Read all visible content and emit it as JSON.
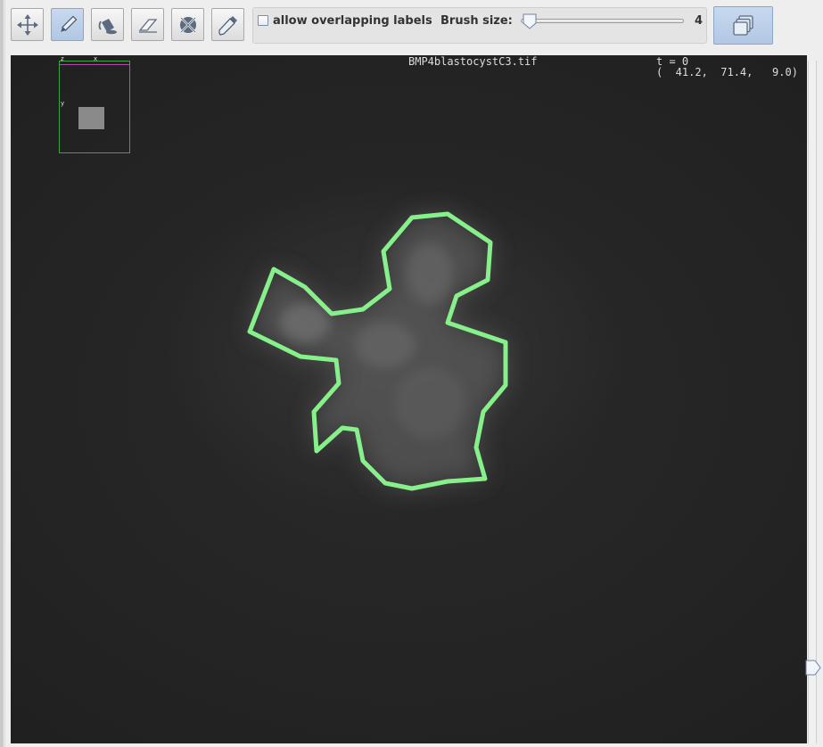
{
  "toolbar": {
    "tools": [
      {
        "id": "move",
        "icon": "move-arrows-icon",
        "active": false
      },
      {
        "id": "draw",
        "icon": "pencil-icon",
        "active": true
      },
      {
        "id": "fill",
        "icon": "paint-bucket-icon",
        "active": false
      },
      {
        "id": "erase",
        "icon": "eraser-icon",
        "active": false
      },
      {
        "id": "delete-label",
        "icon": "delete-label-icon",
        "active": false
      },
      {
        "id": "pick-label",
        "icon": "eyedropper-icon",
        "active": false
      }
    ],
    "allow_overlapping_labels": {
      "label": "allow overlapping labels",
      "checked": false
    },
    "brush_size": {
      "label": "Brush size:",
      "value": "4"
    },
    "window_button_icon": "windows-stack-icon"
  },
  "viewer": {
    "file_title": "BMP4blastocystC3.tif",
    "time_readout": "t = 0",
    "coord_readout": "(  41.2,  71.4,   9.0)",
    "navigator": {
      "z_label": "z",
      "x_label": "x",
      "y_label": "y"
    },
    "label_outline_color": "#86f08a"
  }
}
